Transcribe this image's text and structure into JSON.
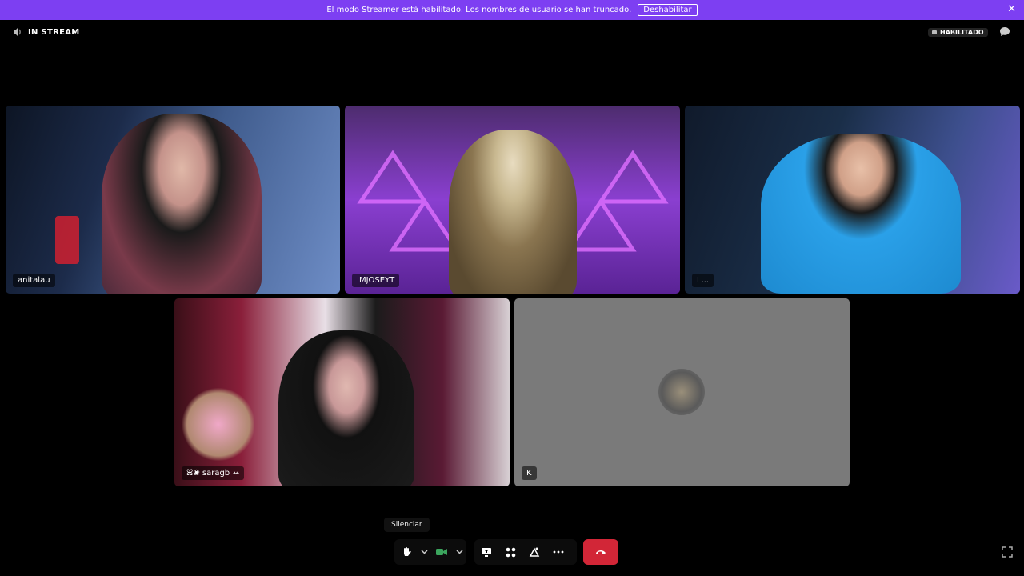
{
  "banner": {
    "message": "El modo Streamer está habilitado. Los nombres de usuario se han truncado.",
    "button": "Deshabilitar",
    "close_icon": "close-icon"
  },
  "header": {
    "status": "IN STREAM",
    "badge": "HABILITADO",
    "status_icon": "volume-icon",
    "chat_icon": "chat-bubble-icon"
  },
  "tiles": [
    {
      "name": "anitalau"
    },
    {
      "name": "IMJOSEYT"
    },
    {
      "name": "L..."
    },
    {
      "name": "ꕤ❀ saragb ꕀ"
    },
    {
      "name": "K"
    }
  ],
  "controls": {
    "tooltip": "Silenciar",
    "icons": [
      "hand-mute-icon",
      "chevron-down-icon",
      "camera-icon",
      "chevron-down-icon",
      "screen-share-icon",
      "activities-icon",
      "soundboard-icon",
      "more-icon",
      "hang-up-icon",
      "expand-icon"
    ]
  },
  "colors": {
    "accent": "#7d3ff2",
    "hangup": "#d22637"
  }
}
